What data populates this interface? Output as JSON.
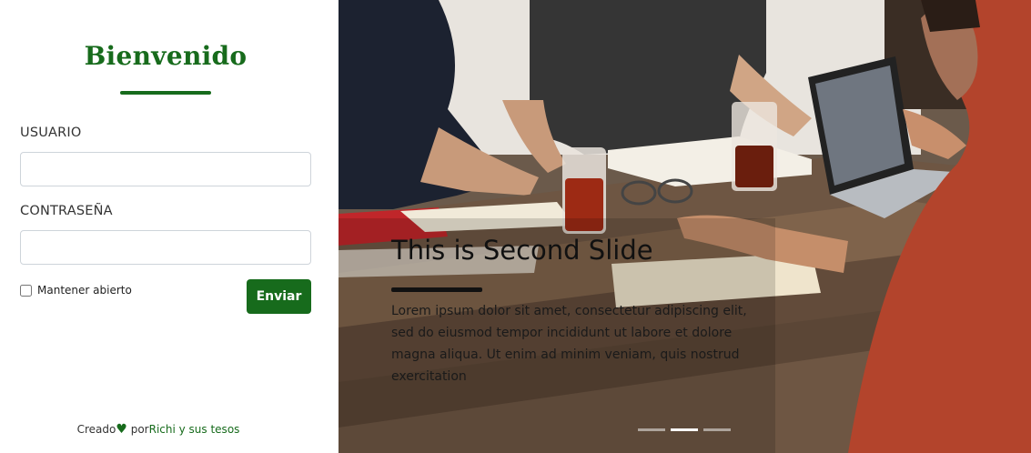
{
  "login": {
    "title": "Bienvenido",
    "user_label": "USUARIO",
    "user_value": "",
    "password_label": "CONTRASEÑA",
    "password_value": "",
    "keep_open_label": "Mantener abierto",
    "keep_open_checked": false,
    "submit_label": "Enviar"
  },
  "footer": {
    "created_text": "Creado",
    "heart_icon": "heart-icon",
    "by_text": " por",
    "author_link": "Richi y sus tesos"
  },
  "carousel": {
    "slide_title": "This is Second Slide",
    "slide_text": "Lorem ipsum dolor sit amet, consectetur adipiscing elit, sed do eiusmod tempor incididunt ut labore et dolore magna aliqua. Ut enim ad minim veniam, quis nostrud exercitation",
    "indicator_count": 3,
    "active_indicator": 2
  },
  "colors": {
    "brand_green": "#176b1c"
  }
}
